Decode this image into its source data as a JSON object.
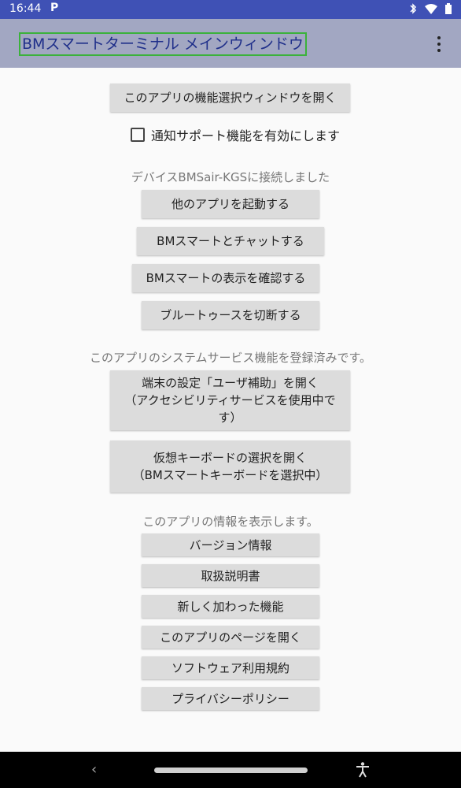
{
  "status_bar": {
    "time": "16:44",
    "left_icon": "P",
    "icons": [
      "bluetooth-icon",
      "wifi-icon",
      "battery-icon"
    ]
  },
  "app_bar": {
    "title": "BMスマートターミナル メインウィンドウ",
    "menu_icon": "overflow-menu-icon"
  },
  "main": {
    "open_function_select": "このアプリの機能選択ウィンドウを開く",
    "notify_checkbox_label": "通知サポート機能を有効にします",
    "device_status": "デバイスBMSair-KGSに接続しました",
    "device_buttons": {
      "launch_other_app": "他のアプリを起動する",
      "chat_bm_smart": "BMスマートとチャットする",
      "check_bm_display": "BMスマートの表示を確認する",
      "disconnect_bluetooth": "ブルートゥースを切断する"
    },
    "system_service_status": "このアプリのシステムサービス機能を登録済みです。",
    "accessibility_button": {
      "line1": "端末の設定「ユーザ補助」を開く",
      "line2": "（アクセシビリティサービスを使用中で",
      "line3": "す）"
    },
    "keyboard_button": {
      "line1": "仮想キーボードの選択を開く",
      "line2": "（BMスマートキーボードを選択中）"
    },
    "info_status": "このアプリの情報を表示します。",
    "info_buttons": {
      "version": "バージョン情報",
      "manual": "取扱説明書",
      "new_features": "新しく加わった機能",
      "app_page": "このアプリのページを開く",
      "license": "ソフトウェア利用規約",
      "privacy": "プライバシーポリシー"
    }
  },
  "nav_bar": {
    "back_glyph": "‹"
  },
  "colors": {
    "status_bar": "#3f51b5",
    "app_bar": "#a2a7c2",
    "title_text": "#1f2f8a",
    "title_outline": "#3bb23b",
    "button_bg": "#dcdcdc",
    "background": "#fafafa"
  }
}
